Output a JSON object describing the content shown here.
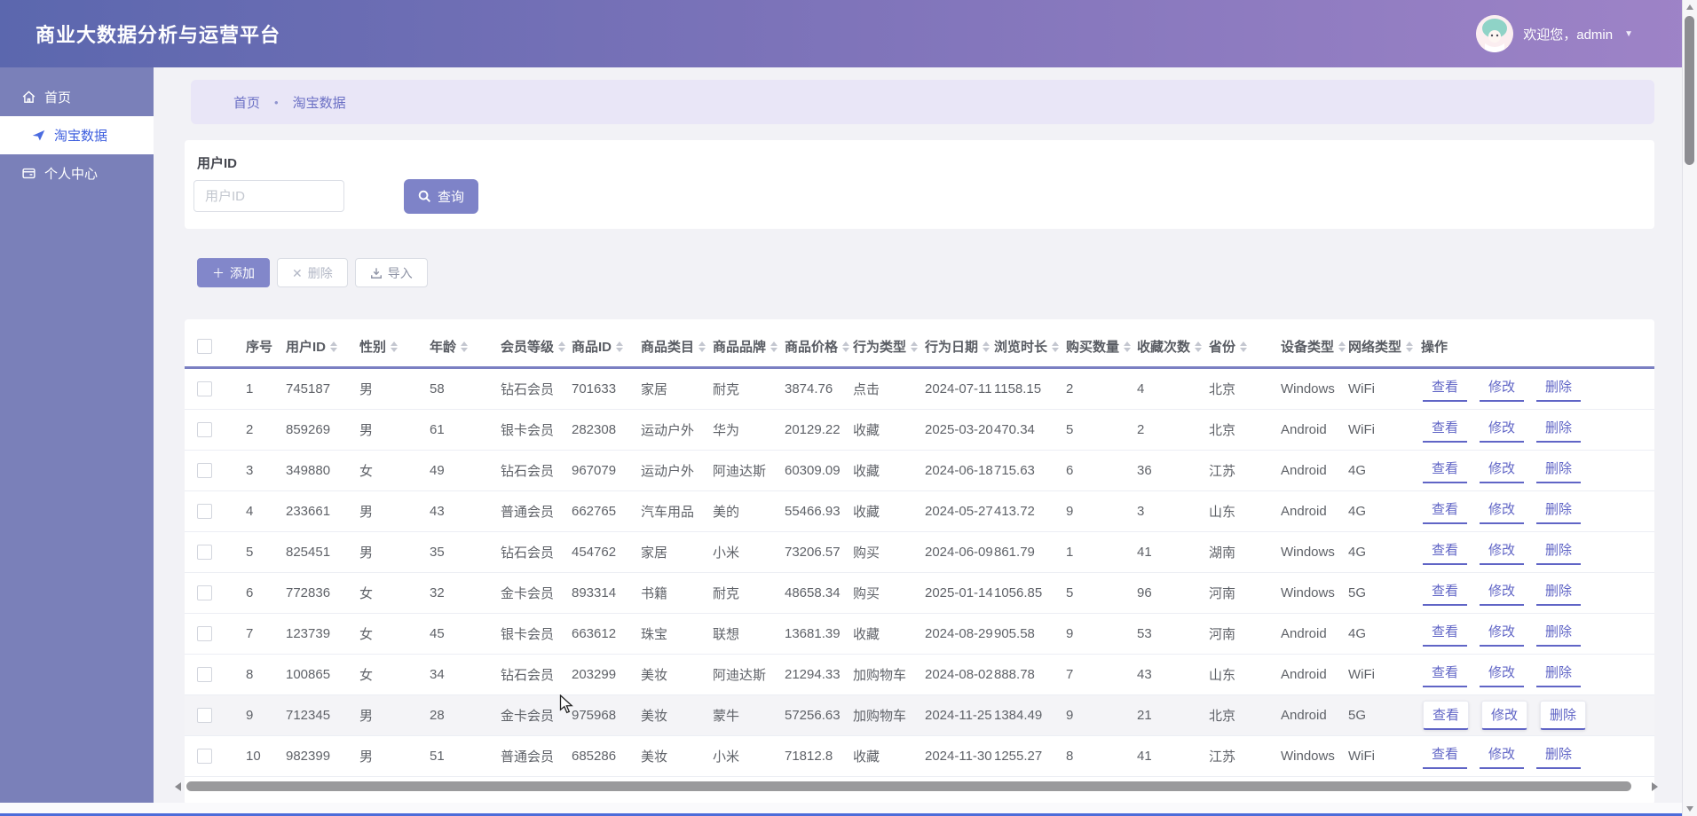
{
  "topbar": {
    "title": "商业大数据分析与运营平台",
    "welcome": "欢迎您，admin",
    "dropdown_icon": "▼"
  },
  "sidebar": {
    "items": [
      {
        "label": "首页",
        "active": false
      },
      {
        "label": "淘宝数据",
        "active": true
      },
      {
        "label": "个人中心",
        "active": false
      }
    ]
  },
  "breadcrumb": {
    "items": [
      "首页",
      "淘宝数据"
    ],
    "separator": "•"
  },
  "search": {
    "label": "用户ID",
    "placeholder": "用户ID",
    "query_button": "查询"
  },
  "toolbar": {
    "add_icon": "＋",
    "add_button": "添加",
    "delete_icon": "✕",
    "delete_button": "删除",
    "import_button": "导入"
  },
  "table": {
    "columns": [
      {
        "label": "序号",
        "sortable": false
      },
      {
        "label": "用户ID",
        "sortable": true
      },
      {
        "label": "性别",
        "sortable": true
      },
      {
        "label": "年龄",
        "sortable": true
      },
      {
        "label": "会员等级",
        "sortable": true
      },
      {
        "label": "商品ID",
        "sortable": true
      },
      {
        "label": "商品类目",
        "sortable": true
      },
      {
        "label": "商品品牌",
        "sortable": true
      },
      {
        "label": "商品价格",
        "sortable": true
      },
      {
        "label": "行为类型",
        "sortable": true
      },
      {
        "label": "行为日期",
        "sortable": true
      },
      {
        "label": "浏览时长",
        "sortable": true
      },
      {
        "label": "购买数量",
        "sortable": true
      },
      {
        "label": "收藏次数",
        "sortable": true
      },
      {
        "label": "省份",
        "sortable": true
      },
      {
        "label": "设备类型",
        "sortable": true
      },
      {
        "label": "网络类型",
        "sortable": true
      },
      {
        "label": "操作",
        "sortable": false
      }
    ],
    "rows": [
      [
        "1",
        "745187",
        "男",
        "58",
        "钻石会员",
        "701633",
        "家居",
        "耐克",
        "3874.76",
        "点击",
        "2024-07-11",
        "1158.15",
        "2",
        "4",
        "北京",
        "Windows",
        "WiFi"
      ],
      [
        "2",
        "859269",
        "男",
        "61",
        "银卡会员",
        "282308",
        "运动户外",
        "华为",
        "20129.22",
        "收藏",
        "2025-03-20",
        "470.34",
        "5",
        "2",
        "北京",
        "Android",
        "WiFi"
      ],
      [
        "3",
        "349880",
        "女",
        "49",
        "钻石会员",
        "967079",
        "运动户外",
        "阿迪达斯",
        "60309.09",
        "收藏",
        "2024-06-18",
        "715.63",
        "6",
        "36",
        "江苏",
        "Android",
        "4G"
      ],
      [
        "4",
        "233661",
        "男",
        "43",
        "普通会员",
        "662765",
        "汽车用品",
        "美的",
        "55466.93",
        "收藏",
        "2024-05-27",
        "413.72",
        "9",
        "3",
        "山东",
        "Android",
        "4G"
      ],
      [
        "5",
        "825451",
        "男",
        "35",
        "钻石会员",
        "454762",
        "家居",
        "小米",
        "73206.57",
        "购买",
        "2024-06-09",
        "861.79",
        "1",
        "41",
        "湖南",
        "Windows",
        "4G"
      ],
      [
        "6",
        "772836",
        "女",
        "32",
        "金卡会员",
        "893314",
        "书籍",
        "耐克",
        "48658.34",
        "购买",
        "2025-01-14",
        "1056.85",
        "5",
        "96",
        "河南",
        "Windows",
        "5G"
      ],
      [
        "7",
        "123739",
        "女",
        "45",
        "银卡会员",
        "663612",
        "珠宝",
        "联想",
        "13681.39",
        "收藏",
        "2024-08-29",
        "905.58",
        "9",
        "53",
        "河南",
        "Android",
        "4G"
      ],
      [
        "8",
        "100865",
        "女",
        "34",
        "钻石会员",
        "203299",
        "美妆",
        "阿迪达斯",
        "21294.33",
        "加购物车",
        "2024-08-02",
        "888.78",
        "7",
        "43",
        "山东",
        "Android",
        "WiFi"
      ],
      [
        "9",
        "712345",
        "男",
        "28",
        "金卡会员",
        "975968",
        "美妆",
        "蒙牛",
        "57256.63",
        "加购物车",
        "2024-11-25",
        "1384.49",
        "9",
        "21",
        "北京",
        "Android",
        "5G"
      ],
      [
        "10",
        "982399",
        "男",
        "51",
        "普通会员",
        "685286",
        "美妆",
        "小米",
        "71812.8",
        "收藏",
        "2024-11-30",
        "1255.27",
        "8",
        "41",
        "江苏",
        "Windows",
        "WiFi"
      ]
    ],
    "row_actions": [
      "查看",
      "修改",
      "删除"
    ],
    "hovered_row": 9
  },
  "colors": {
    "topbar_gradient_left": "#5b67ae",
    "topbar_gradient_right": "#9e83c7",
    "sidebar_bg": "#7a80b9",
    "sidebar_active_text": "#3d5ede",
    "breadcrumb_bg": "#e9e6f7",
    "accent_purple": "#7e83c8",
    "link_purple": "#6065c6",
    "table_header_underline": "#7a7fc2"
  }
}
